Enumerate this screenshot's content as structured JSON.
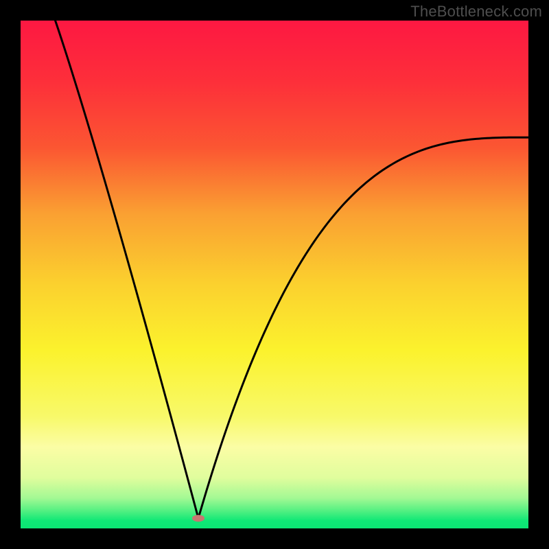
{
  "watermark": "TheBottleneck.com",
  "chart_data": {
    "type": "line",
    "title": "",
    "xlabel": "",
    "ylabel": "",
    "xlim": [
      0,
      100
    ],
    "ylim": [
      0,
      100
    ],
    "grid": false,
    "curve": {
      "name": "bottleneck-curve",
      "x_min_value": 35,
      "points": [
        {
          "x": 5,
          "y": 105
        },
        {
          "x": 35,
          "y": 2
        },
        {
          "x": 100,
          "y": 77
        }
      ],
      "note": "Single black V-shaped curve; near-linear descent to vertex then convex rise. Values estimated from axis-free figure as percentages of plot area."
    },
    "vertex_marker": {
      "x": 35,
      "y": 2,
      "color": "#c77771",
      "rx": 9,
      "ry": 5
    },
    "background_gradient": {
      "direction": "top-to-bottom",
      "stops": [
        {
          "pos": 0.0,
          "color": "#fd1842"
        },
        {
          "pos": 0.12,
          "color": "#fd2f3a"
        },
        {
          "pos": 0.25,
          "color": "#fb5632"
        },
        {
          "pos": 0.38,
          "color": "#faa032"
        },
        {
          "pos": 0.52,
          "color": "#fbd12e"
        },
        {
          "pos": 0.65,
          "color": "#fbf22d"
        },
        {
          "pos": 0.78,
          "color": "#f8f96a"
        },
        {
          "pos": 0.84,
          "color": "#fbfda5"
        },
        {
          "pos": 0.9,
          "color": "#e0fd9d"
        },
        {
          "pos": 0.94,
          "color": "#a4f994"
        },
        {
          "pos": 0.965,
          "color": "#54f082"
        },
        {
          "pos": 0.985,
          "color": "#0fe876"
        },
        {
          "pos": 1.0,
          "color": "#0be574"
        }
      ]
    }
  }
}
